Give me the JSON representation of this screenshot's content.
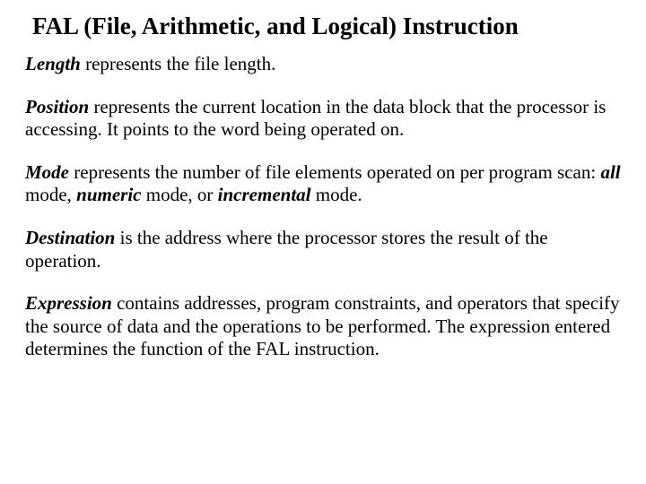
{
  "title": "FAL (File, Arithmetic, and Logical) Instruction",
  "defs": {
    "length": {
      "term": "Length",
      "after": " represents the file length."
    },
    "position": {
      "term": "Position",
      "after": " represents the current location in the data block that the processor is accessing. It points to the word being operated on."
    },
    "mode": {
      "term": "Mode",
      "after1": " represents the number of file elements operated on per program scan: ",
      "kw_all": "all",
      "txt1": " mode, ",
      "kw_num": "numeric",
      "txt2": " mode, or ",
      "kw_inc": "incremental",
      "txt3": " mode."
    },
    "destination": {
      "term": "Destination",
      "after": " is the address where the processor stores the result of the operation."
    },
    "expression": {
      "term": "Expression",
      "after": " contains addresses, program constraints, and operators that specify the source of data and the operations to be performed. The expression entered determines the function of the FAL instruction."
    }
  }
}
